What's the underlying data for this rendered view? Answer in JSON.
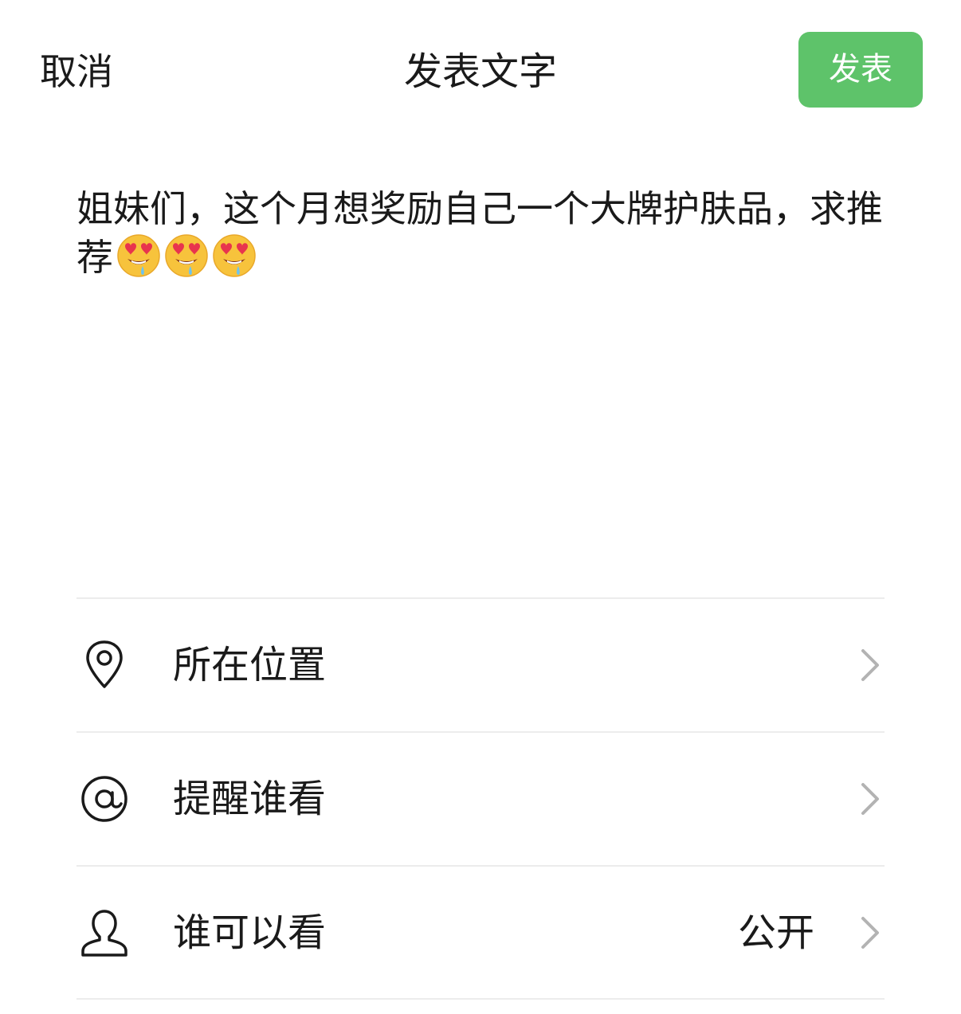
{
  "header": {
    "cancel_label": "取消",
    "title": "发表文字",
    "publish_label": "发表"
  },
  "compose": {
    "text": "姐妹们，这个月想奖励自己一个大牌护肤品，求推荐",
    "emoji": [
      "heart-eyes-drooling-emoji",
      "heart-eyes-drooling-emoji",
      "heart-eyes-drooling-emoji"
    ]
  },
  "options": [
    {
      "label": "所在位置",
      "icon": "location-pin-icon",
      "value": ""
    },
    {
      "label": "提醒谁看",
      "icon": "at-sign-icon",
      "value": ""
    },
    {
      "label": "谁可以看",
      "icon": "person-icon",
      "value": "公开"
    }
  ],
  "colors": {
    "accent": "#5ec36a",
    "text": "#1a1a1a",
    "divider": "#ececec",
    "chevron": "#b3b3b3"
  }
}
